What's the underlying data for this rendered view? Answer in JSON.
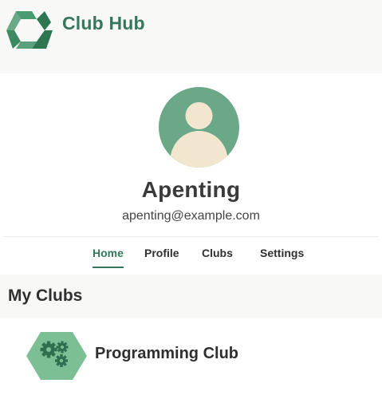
{
  "header": {
    "brand": "Club Hub",
    "logo_icon": "club-hub-logo-icon",
    "brand_color": "#35775a"
  },
  "profile": {
    "name": "Apenting",
    "email": "apenting@example.com",
    "avatar_icon": "user-avatar-icon",
    "avatar_bg": "#6aa888",
    "avatar_fg": "#f2e6cf"
  },
  "nav": {
    "tabs": [
      {
        "label": "Home",
        "active": true
      },
      {
        "label": "Profile",
        "active": false
      },
      {
        "label": "Clubs",
        "active": false
      },
      {
        "label": "Settings",
        "active": false
      }
    ],
    "accent": "#35775a"
  },
  "my_clubs": {
    "title": "My Clubs",
    "items": [
      {
        "name": "Programming Club",
        "icon": "gears-icon",
        "icon_bg": "#7dbf95"
      }
    ]
  }
}
